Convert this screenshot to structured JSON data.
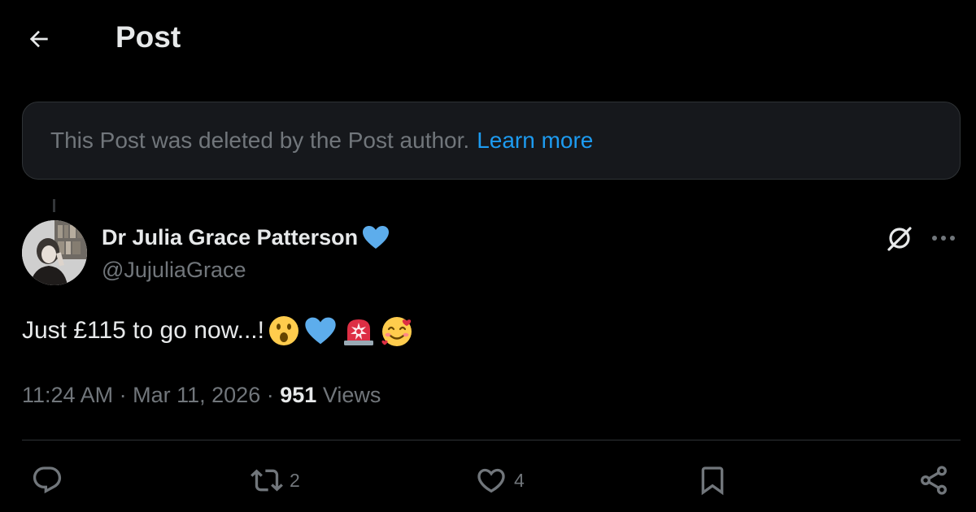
{
  "header": {
    "title": "Post",
    "back_icon": "arrow-left-icon"
  },
  "deleted_notice": {
    "text": "This Post was deleted by the Post author.",
    "link_text": "Learn more",
    "link_color": "#1d9bf0"
  },
  "post": {
    "author": {
      "display_name": "Dr Julia Grace Patterson",
      "name_emoji": "blue-heart-icon",
      "handle": "@JujuliaGrace"
    },
    "text": "Just £115 to go now...!",
    "emojis": [
      "astonished-face-icon",
      "blue-heart-icon",
      "police-light-icon",
      "smiling-face-with-hearts-icon"
    ],
    "time": "11:24 AM",
    "separator": "·",
    "date": "Mar 11, 2026",
    "views_count": "951",
    "views_label": "Views"
  },
  "actions": {
    "reply": {
      "icon": "reply-icon",
      "count": ""
    },
    "repost": {
      "icon": "repost-icon",
      "count": "2"
    },
    "like": {
      "icon": "heart-icon",
      "count": "4"
    },
    "bookmark": {
      "icon": "bookmark-icon",
      "count": ""
    },
    "share": {
      "icon": "share-icon",
      "count": ""
    }
  },
  "colors": {
    "background": "#000000",
    "primary_text": "#e7e9ea",
    "secondary_text": "#71767b",
    "accent": "#1d9bf0",
    "card_background": "#16181c",
    "border": "#2f3336"
  }
}
